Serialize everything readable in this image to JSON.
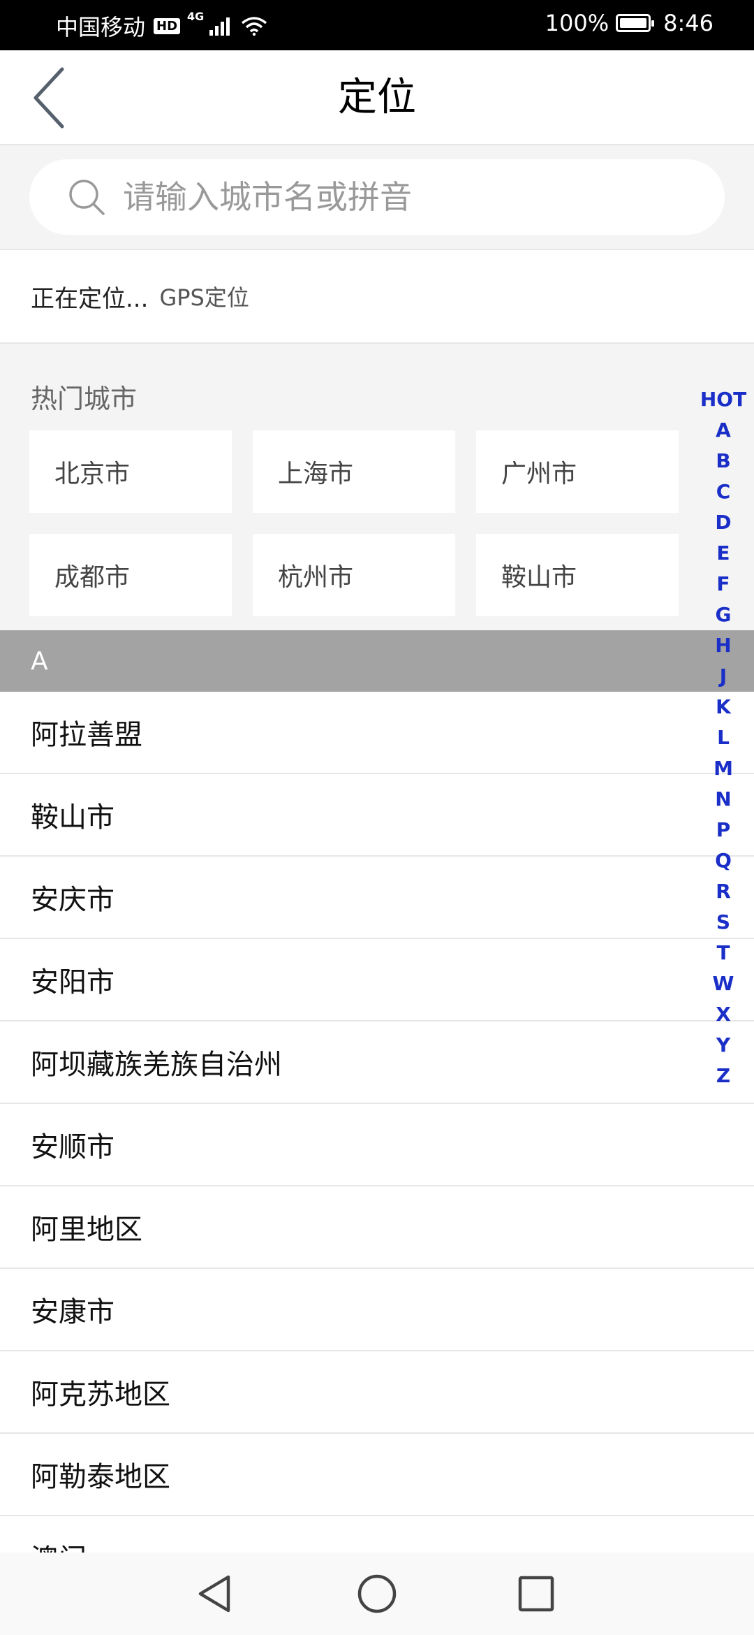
{
  "status_bar": {
    "carrier": "中国移动",
    "hd": "HD",
    "network": "4G",
    "battery": "100%",
    "time": "8:46"
  },
  "header": {
    "title": "定位",
    "back_icon": "chevron-left-icon"
  },
  "search": {
    "placeholder": "请输入城市名或拼音",
    "value": "",
    "icon": "search-icon"
  },
  "location": {
    "status": "正在定位...",
    "method": "GPS定位"
  },
  "hot_cities": {
    "title": "热门城市",
    "items": [
      "北京市",
      "上海市",
      "广州市",
      "成都市",
      "杭州市",
      "鞍山市"
    ]
  },
  "section": {
    "letter": "A"
  },
  "city_list": [
    "阿拉善盟",
    "鞍山市",
    "安庆市",
    "安阳市",
    "阿坝藏族羌族自治州",
    "安顺市",
    "阿里地区",
    "安康市",
    "阿克苏地区",
    "阿勒泰地区",
    "澳门"
  ],
  "letter_index": [
    "HOT",
    "A",
    "B",
    "C",
    "D",
    "E",
    "F",
    "G",
    "H",
    "J",
    "K",
    "L",
    "M",
    "N",
    "P",
    "Q",
    "R",
    "S",
    "T",
    "W",
    "X",
    "Y",
    "Z"
  ],
  "colors": {
    "index_letter": "#1a2ec8",
    "section_header_bg": "#a3a3a3",
    "page_bg": "#f4f4f4"
  },
  "bottom_nav": {
    "back": "triangle-back-icon",
    "home": "circle-home-icon",
    "recents": "square-recents-icon"
  }
}
